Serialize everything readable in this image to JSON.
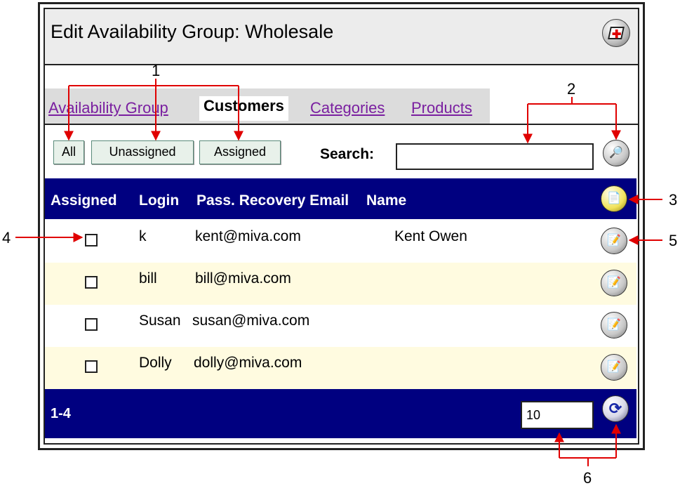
{
  "window": {
    "title": "Edit Availability Group: Wholesale",
    "help_icon": "help-plus-icon"
  },
  "tabs": [
    {
      "label": "Availability Group",
      "active": false
    },
    {
      "label": "Customers",
      "active": true
    },
    {
      "label": "Categories",
      "active": false
    },
    {
      "label": "Products",
      "active": false
    }
  ],
  "filters": {
    "all": "All",
    "unassigned": "Unassigned",
    "assigned": "Assigned"
  },
  "search": {
    "label": "Search:",
    "value": "",
    "button_icon": "binoculars-icon"
  },
  "table": {
    "headers": [
      "Assigned",
      "Login",
      "Pass. Recovery Email",
      "Name"
    ],
    "header_icon": "add-document-icon",
    "rows": [
      {
        "login": "k",
        "email": "kent@miva.com",
        "name": "Kent Owen",
        "assigned": false
      },
      {
        "login": "bill",
        "email": "bill@miva.com",
        "name": "",
        "assigned": false
      },
      {
        "login": "Susan",
        "email": "susan@miva.com",
        "name": "",
        "assigned": false
      },
      {
        "login": "Dolly",
        "email": "dolly@miva.com",
        "name": "",
        "assigned": false
      }
    ]
  },
  "footer": {
    "range": "1-4",
    "page_size": "10",
    "refresh_icon": "refresh-icon"
  },
  "annotations": {
    "a1": "1",
    "a2": "2",
    "a3": "3",
    "a4": "4",
    "a5": "5",
    "a6": "6"
  },
  "colors": {
    "header_bg": "#000080",
    "alt_row_bg": "#fffbe0",
    "callout": "#e00000",
    "link": "#7a1fa0"
  }
}
